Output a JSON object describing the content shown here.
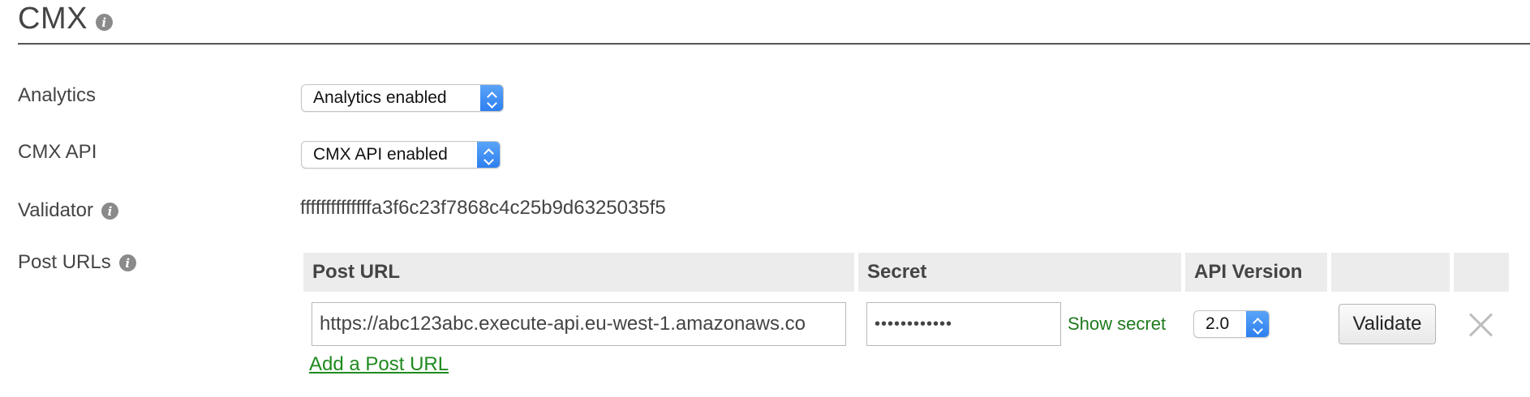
{
  "section": {
    "title": "CMX"
  },
  "analytics": {
    "label": "Analytics",
    "selected": "Analytics enabled"
  },
  "cmx_api": {
    "label": "CMX API",
    "selected": "CMX API enabled"
  },
  "validator": {
    "label": "Validator",
    "value": "ffffffffffffffa3f6c23f7868c4c25b9d6325035f5"
  },
  "post_urls": {
    "label": "Post URLs",
    "headers": {
      "post_url": "Post URL",
      "secret": "Secret",
      "api_version": "API Version"
    },
    "row": {
      "url": "https://abc123abc.execute-api.eu-west-1.amazonaws.co",
      "secret_masked": "••••••••••••",
      "show_secret": "Show secret",
      "api_version": "2.0",
      "validate": "Validate"
    },
    "add_link": "Add a Post URL"
  },
  "colors": {
    "accent_blue": "#2d7ff0",
    "link_green": "#1f7a1f"
  }
}
